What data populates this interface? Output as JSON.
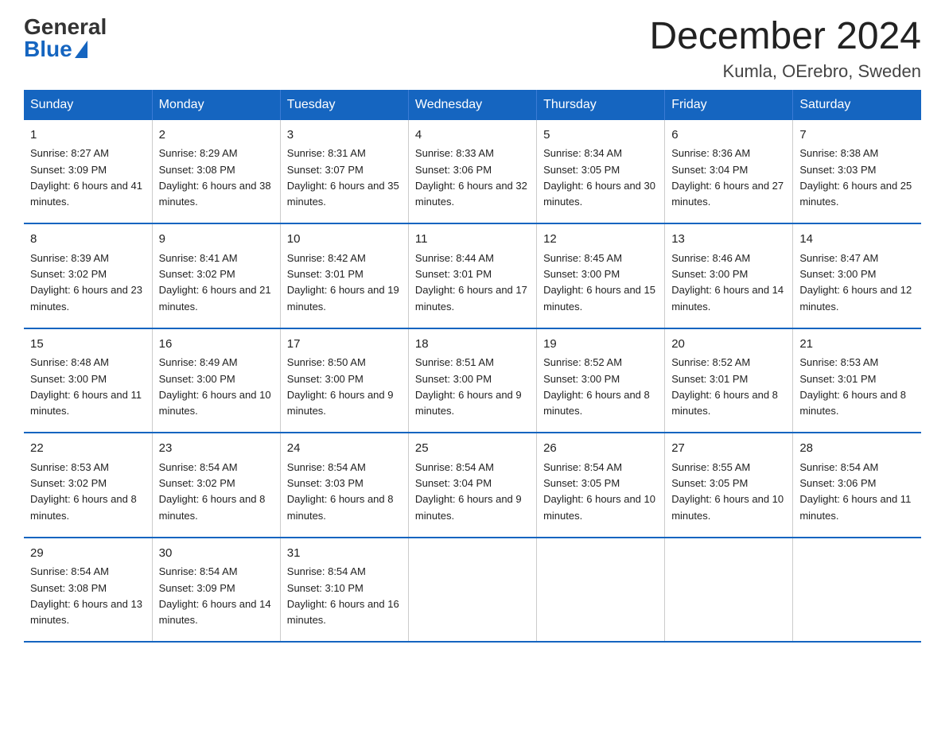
{
  "logo": {
    "general": "General",
    "blue": "Blue"
  },
  "title": "December 2024",
  "location": "Kumla, OErebro, Sweden",
  "weekdays": [
    "Sunday",
    "Monday",
    "Tuesday",
    "Wednesday",
    "Thursday",
    "Friday",
    "Saturday"
  ],
  "weeks": [
    [
      {
        "day": "1",
        "sunrise": "8:27 AM",
        "sunset": "3:09 PM",
        "daylight": "6 hours and 41 minutes."
      },
      {
        "day": "2",
        "sunrise": "8:29 AM",
        "sunset": "3:08 PM",
        "daylight": "6 hours and 38 minutes."
      },
      {
        "day": "3",
        "sunrise": "8:31 AM",
        "sunset": "3:07 PM",
        "daylight": "6 hours and 35 minutes."
      },
      {
        "day": "4",
        "sunrise": "8:33 AM",
        "sunset": "3:06 PM",
        "daylight": "6 hours and 32 minutes."
      },
      {
        "day": "5",
        "sunrise": "8:34 AM",
        "sunset": "3:05 PM",
        "daylight": "6 hours and 30 minutes."
      },
      {
        "day": "6",
        "sunrise": "8:36 AM",
        "sunset": "3:04 PM",
        "daylight": "6 hours and 27 minutes."
      },
      {
        "day": "7",
        "sunrise": "8:38 AM",
        "sunset": "3:03 PM",
        "daylight": "6 hours and 25 minutes."
      }
    ],
    [
      {
        "day": "8",
        "sunrise": "8:39 AM",
        "sunset": "3:02 PM",
        "daylight": "6 hours and 23 minutes."
      },
      {
        "day": "9",
        "sunrise": "8:41 AM",
        "sunset": "3:02 PM",
        "daylight": "6 hours and 21 minutes."
      },
      {
        "day": "10",
        "sunrise": "8:42 AM",
        "sunset": "3:01 PM",
        "daylight": "6 hours and 19 minutes."
      },
      {
        "day": "11",
        "sunrise": "8:44 AM",
        "sunset": "3:01 PM",
        "daylight": "6 hours and 17 minutes."
      },
      {
        "day": "12",
        "sunrise": "8:45 AM",
        "sunset": "3:00 PM",
        "daylight": "6 hours and 15 minutes."
      },
      {
        "day": "13",
        "sunrise": "8:46 AM",
        "sunset": "3:00 PM",
        "daylight": "6 hours and 14 minutes."
      },
      {
        "day": "14",
        "sunrise": "8:47 AM",
        "sunset": "3:00 PM",
        "daylight": "6 hours and 12 minutes."
      }
    ],
    [
      {
        "day": "15",
        "sunrise": "8:48 AM",
        "sunset": "3:00 PM",
        "daylight": "6 hours and 11 minutes."
      },
      {
        "day": "16",
        "sunrise": "8:49 AM",
        "sunset": "3:00 PM",
        "daylight": "6 hours and 10 minutes."
      },
      {
        "day": "17",
        "sunrise": "8:50 AM",
        "sunset": "3:00 PM",
        "daylight": "6 hours and 9 minutes."
      },
      {
        "day": "18",
        "sunrise": "8:51 AM",
        "sunset": "3:00 PM",
        "daylight": "6 hours and 9 minutes."
      },
      {
        "day": "19",
        "sunrise": "8:52 AM",
        "sunset": "3:00 PM",
        "daylight": "6 hours and 8 minutes."
      },
      {
        "day": "20",
        "sunrise": "8:52 AM",
        "sunset": "3:01 PM",
        "daylight": "6 hours and 8 minutes."
      },
      {
        "day": "21",
        "sunrise": "8:53 AM",
        "sunset": "3:01 PM",
        "daylight": "6 hours and 8 minutes."
      }
    ],
    [
      {
        "day": "22",
        "sunrise": "8:53 AM",
        "sunset": "3:02 PM",
        "daylight": "6 hours and 8 minutes."
      },
      {
        "day": "23",
        "sunrise": "8:54 AM",
        "sunset": "3:02 PM",
        "daylight": "6 hours and 8 minutes."
      },
      {
        "day": "24",
        "sunrise": "8:54 AM",
        "sunset": "3:03 PM",
        "daylight": "6 hours and 8 minutes."
      },
      {
        "day": "25",
        "sunrise": "8:54 AM",
        "sunset": "3:04 PM",
        "daylight": "6 hours and 9 minutes."
      },
      {
        "day": "26",
        "sunrise": "8:54 AM",
        "sunset": "3:05 PM",
        "daylight": "6 hours and 10 minutes."
      },
      {
        "day": "27",
        "sunrise": "8:55 AM",
        "sunset": "3:05 PM",
        "daylight": "6 hours and 10 minutes."
      },
      {
        "day": "28",
        "sunrise": "8:54 AM",
        "sunset": "3:06 PM",
        "daylight": "6 hours and 11 minutes."
      }
    ],
    [
      {
        "day": "29",
        "sunrise": "8:54 AM",
        "sunset": "3:08 PM",
        "daylight": "6 hours and 13 minutes."
      },
      {
        "day": "30",
        "sunrise": "8:54 AM",
        "sunset": "3:09 PM",
        "daylight": "6 hours and 14 minutes."
      },
      {
        "day": "31",
        "sunrise": "8:54 AM",
        "sunset": "3:10 PM",
        "daylight": "6 hours and 16 minutes."
      },
      null,
      null,
      null,
      null
    ]
  ],
  "colors": {
    "header_bg": "#1a6bbf",
    "border": "#1a6bbf"
  }
}
